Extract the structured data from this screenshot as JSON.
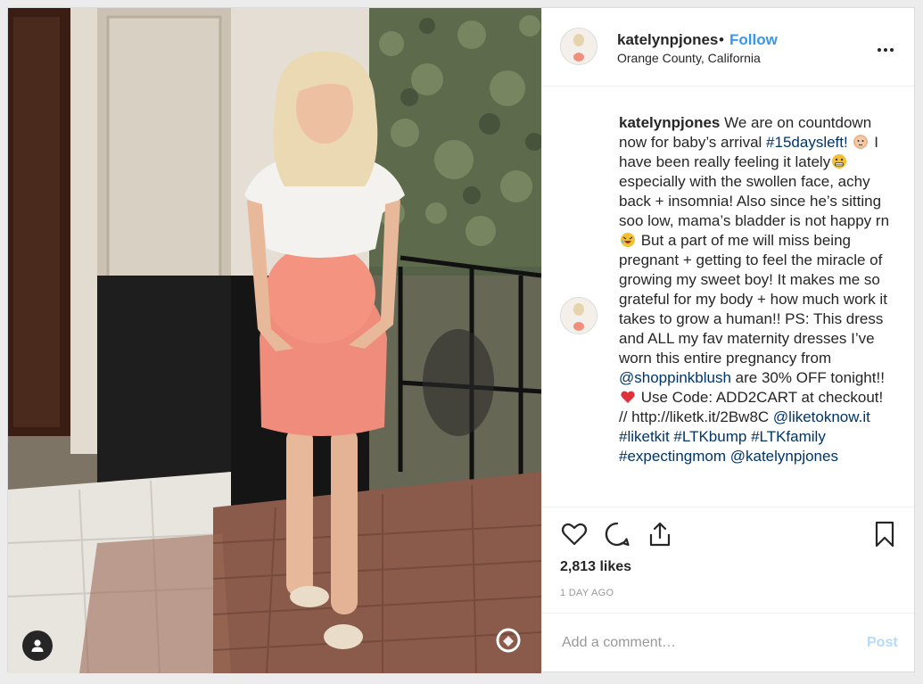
{
  "post": {
    "username": "katelynpjones",
    "separator": "•",
    "follow_label": "Follow",
    "location": "Orange County, California"
  },
  "caption": {
    "username": "katelynpjones",
    "seg1": " We are on countdown now for baby’s arrival ",
    "tag1": "#15daysleft!",
    "seg2": " I have been really feeling it lately",
    "seg3": " especially with the swollen face, achy back + insomnia! Also since he’s sitting soo low, mama’s bladder is not happy rn",
    "seg4": " But a part of me will miss being pregnant + getting to feel the miracle of growing my sweet boy! It makes me so grateful for my body + how much work it takes to grow a human!! PS: This dress and ALL my fav maternity dresses I’ve worn this entire pregnancy from ",
    "mention1": "@shoppinkblush",
    "seg5": " are 30% OFF tonight!!",
    "seg6": " Use Code: ADD2CART at checkout! // http://liketk.it/2Bw8C ",
    "mention2": "@liketoknow.it",
    "tag2": "#liketkit",
    "tag3": "#LTKbump",
    "tag4": "#LTKfamily",
    "tag5": "#expectingmom",
    "mention3": "@katelynpjones"
  },
  "stats": {
    "likes": "2,813 likes",
    "time_ago": "1 DAY AGO"
  },
  "comment": {
    "placeholder": "Add a comment…",
    "post_label": "Post"
  },
  "icons": {
    "like": "heart-outline-icon",
    "comment": "speech-bubble-icon",
    "share": "share-upload-icon",
    "save": "bookmark-icon",
    "more": "three-dots-icon",
    "user_tags": "person-icon",
    "ltk": "ltk-watermark-icon"
  },
  "colors": {
    "accent": "#3897f0",
    "hashtag": "#003569",
    "muted": "#999999",
    "post_disabled": "#b3dbff"
  }
}
